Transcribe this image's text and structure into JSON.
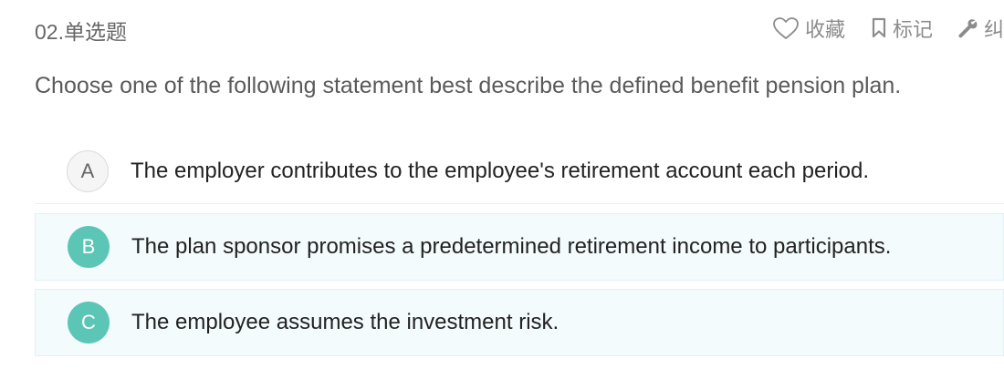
{
  "question": {
    "number_label": "02.单选题",
    "text": "Choose one of the following statement best describe the defined benefit pension plan."
  },
  "actions": {
    "favorite": {
      "label": "收藏",
      "icon": "heart-outline-icon"
    },
    "mark": {
      "label": "标记",
      "icon": "bookmark-icon"
    },
    "correction": {
      "label": "纠",
      "icon": "wrench-icon"
    }
  },
  "options": [
    {
      "letter": "A",
      "text": "The employer contributes to the employee's retirement account each period.",
      "state": "default"
    },
    {
      "letter": "B",
      "text": "The plan sponsor promises a predetermined retirement income to participants.",
      "state": "highlighted"
    },
    {
      "letter": "C",
      "text": "The employee assumes the investment risk.",
      "state": "highlighted"
    }
  ],
  "colors": {
    "accent_teal": "#5cc6b6",
    "highlight_bg": "#f4fbfd",
    "muted_text": "#8c8c8c"
  }
}
